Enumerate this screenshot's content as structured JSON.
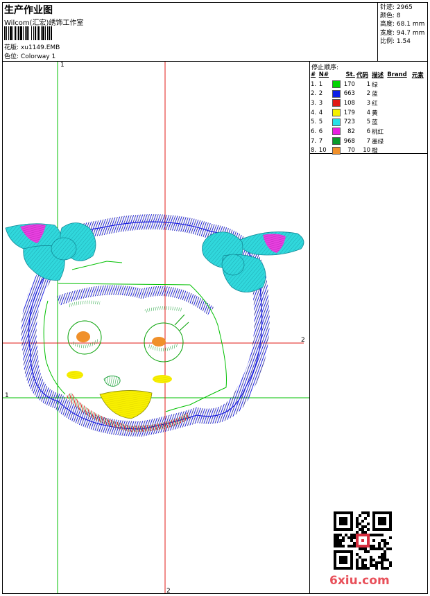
{
  "header": {
    "title": "生产作业图",
    "company": "Wilcom(汇宏)绣饰工作室",
    "design_label": "花版:",
    "design_value": "xu1149.EMB",
    "colorway_label": "色位:",
    "colorway_value": "Colorway 1"
  },
  "stats": [
    {
      "label": "针迹:",
      "value": "2965"
    },
    {
      "label": "颜色:",
      "value": "8"
    },
    {
      "label": "高度:",
      "value": "68.1 mm"
    },
    {
      "label": "宽度:",
      "value": "94.7 mm"
    },
    {
      "label": "比例:",
      "value": "1.54"
    }
  ],
  "stop_sequence": {
    "title": "停止顺序:",
    "headers": [
      "#",
      "N#",
      "St.",
      "代码",
      "描述",
      "Brand",
      "元素"
    ],
    "rows": [
      {
        "idx": "1.",
        "n": "1",
        "color": "#00d400",
        "st": "170",
        "code": "1",
        "desc": "绿"
      },
      {
        "idx": "2.",
        "n": "2",
        "color": "#0a1ee6",
        "st": "663",
        "code": "2",
        "desc": "蓝"
      },
      {
        "idx": "3.",
        "n": "3",
        "color": "#e01a14",
        "st": "108",
        "code": "3",
        "desc": "红"
      },
      {
        "idx": "4.",
        "n": "4",
        "color": "#f5f000",
        "st": "179",
        "code": "4",
        "desc": "黄"
      },
      {
        "idx": "5.",
        "n": "5",
        "color": "#26e0e8",
        "st": "723",
        "code": "5",
        "desc": "蓝"
      },
      {
        "idx": "6.",
        "n": "6",
        "color": "#e81ee0",
        "st": "82",
        "code": "6",
        "desc": "桃红"
      },
      {
        "idx": "7.",
        "n": "7",
        "color": "#0a9a2a",
        "st": "968",
        "code": "7",
        "desc": "墨绿"
      },
      {
        "idx": "8.",
        "n": "10",
        "color": "#f0902a",
        "st": "70",
        "code": "10",
        "desc": "橙"
      }
    ]
  },
  "axes": {
    "v1": "1",
    "v2": "2",
    "h1": "1",
    "h2": "2"
  },
  "watermark": "6xiu.com",
  "colors": {
    "crosshair_red": "#e01a14",
    "crosshair_green": "#00c000"
  }
}
